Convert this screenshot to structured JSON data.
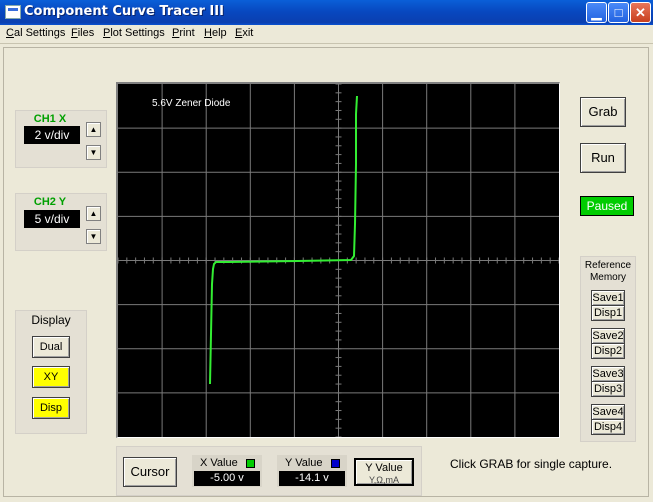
{
  "window": {
    "title": "Component Curve Tracer III"
  },
  "menu": {
    "items": [
      {
        "prefix": "C",
        "rest": "al Settings"
      },
      {
        "prefix": "F",
        "rest": "iles"
      },
      {
        "prefix": "P",
        "rest": "lot Settings"
      },
      {
        "prefix": "P",
        "rest": "rint"
      },
      {
        "prefix": "H",
        "rest": "elp"
      },
      {
        "prefix": "E",
        "rest": "xit"
      }
    ]
  },
  "ch1": {
    "label": "CH1 X",
    "value": "2 v/div",
    "color": "#00a000"
  },
  "ch2": {
    "label": "CH2 Y",
    "value": "5 v/div",
    "color": "#00a000"
  },
  "display": {
    "title": "Display",
    "dual_label": "Dual",
    "xy_label": "XY",
    "disp_label": "Disp"
  },
  "scope": {
    "trace_label": "5.6V Zener Diode",
    "trace_color": "#33ee33",
    "grid_color": "#7a7a7a"
  },
  "controls": {
    "grab_label": "Grab",
    "run_label": "Run",
    "status_label": "Paused",
    "status_color": "#00cc00"
  },
  "reference": {
    "title_line1": "Reference",
    "title_line2": "Memory",
    "slots": [
      {
        "save": "Save1",
        "disp": "Disp1"
      },
      {
        "save": "Save2",
        "disp": "Disp2"
      },
      {
        "save": "Save3",
        "disp": "Disp3"
      },
      {
        "save": "Save4",
        "disp": "Disp4"
      }
    ]
  },
  "bottom": {
    "cursor_label": "Cursor",
    "x_value_label": "X Value",
    "x_value": "-5.00 v",
    "x_marker_color": "#00cc00",
    "y_value_label": "Y Value",
    "y_value": "-14.1 v",
    "y_marker_color": "#0000cc",
    "y_button_label": "Y Value",
    "y_button_sub": "Y,Ω,mA",
    "hint": "Click GRAB for single capture."
  }
}
